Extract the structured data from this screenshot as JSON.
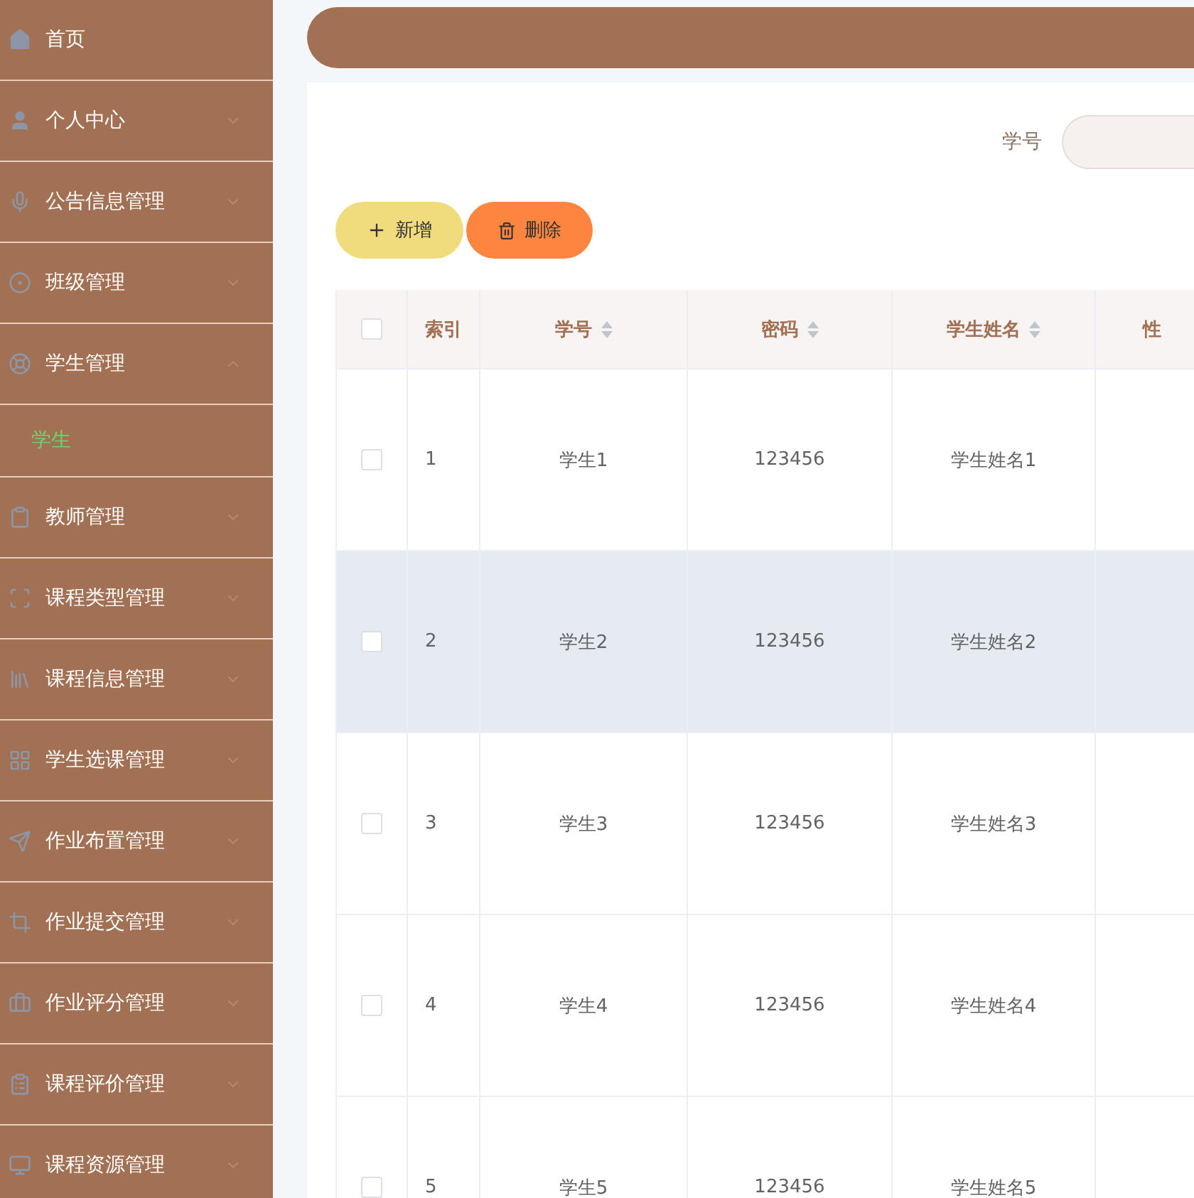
{
  "sidebar": {
    "items": [
      {
        "label": "首页"
      },
      {
        "label": "个人中心",
        "expanded": false
      },
      {
        "label": "公告信息管理",
        "expanded": false
      },
      {
        "label": "班级管理",
        "expanded": false
      },
      {
        "label": "学生管理",
        "expanded": true,
        "children": [
          {
            "label": "学生",
            "selected": true
          }
        ]
      },
      {
        "label": "教师管理",
        "expanded": false
      },
      {
        "label": "课程类型管理",
        "expanded": false
      },
      {
        "label": "课程信息管理",
        "expanded": false
      },
      {
        "label": "学生选课管理",
        "expanded": false
      },
      {
        "label": "作业布置管理",
        "expanded": false
      },
      {
        "label": "作业提交管理",
        "expanded": false
      },
      {
        "label": "作业评分管理",
        "expanded": false
      },
      {
        "label": "课程评价管理",
        "expanded": false
      },
      {
        "label": "课程资源管理",
        "expanded": false
      }
    ]
  },
  "search": {
    "label": "学号"
  },
  "buttons": [
    {
      "label": "新增",
      "kind": "add"
    },
    {
      "label": "删除",
      "kind": "delete"
    }
  ],
  "table": {
    "select_all": {
      "checked": false
    },
    "columns": [
      {
        "label": "索引",
        "sortable": false
      },
      {
        "label": "学号",
        "sortable": true
      },
      {
        "label": "密码",
        "sortable": true
      },
      {
        "label": "学生姓名",
        "sortable": true
      },
      {
        "label": "性",
        "sortable": false
      }
    ],
    "rows": [
      {
        "checked": false,
        "hovered": false,
        "cells": [
          "1",
          "学生1",
          "123456",
          "学生姓名1"
        ]
      },
      {
        "checked": false,
        "hovered": true,
        "cells": [
          "2",
          "学生2",
          "123456",
          "学生姓名2"
        ]
      },
      {
        "checked": false,
        "hovered": false,
        "cells": [
          "3",
          "学生3",
          "123456",
          "学生姓名3"
        ]
      },
      {
        "checked": false,
        "hovered": false,
        "cells": [
          "4",
          "学生4",
          "123456",
          "学生姓名4"
        ]
      },
      {
        "checked": false,
        "hovered": false,
        "cells": [
          "5",
          "学生5",
          "123456",
          "学生姓名5"
        ]
      }
    ]
  }
}
